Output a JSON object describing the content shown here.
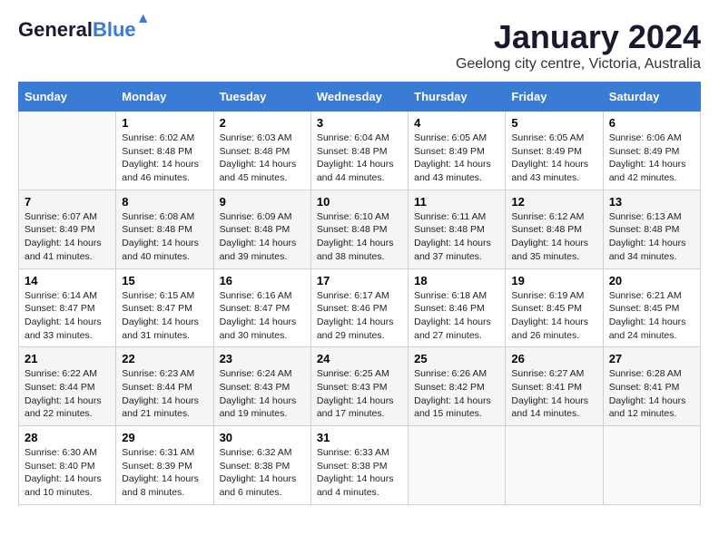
{
  "header": {
    "logo_general": "General",
    "logo_blue": "Blue",
    "month": "January 2024",
    "location": "Geelong city centre, Victoria, Australia"
  },
  "days_of_week": [
    "Sunday",
    "Monday",
    "Tuesday",
    "Wednesday",
    "Thursday",
    "Friday",
    "Saturday"
  ],
  "weeks": [
    [
      {
        "day": "",
        "info": ""
      },
      {
        "day": "1",
        "info": "Sunrise: 6:02 AM\nSunset: 8:48 PM\nDaylight: 14 hours\nand 46 minutes."
      },
      {
        "day": "2",
        "info": "Sunrise: 6:03 AM\nSunset: 8:48 PM\nDaylight: 14 hours\nand 45 minutes."
      },
      {
        "day": "3",
        "info": "Sunrise: 6:04 AM\nSunset: 8:48 PM\nDaylight: 14 hours\nand 44 minutes."
      },
      {
        "day": "4",
        "info": "Sunrise: 6:05 AM\nSunset: 8:49 PM\nDaylight: 14 hours\nand 43 minutes."
      },
      {
        "day": "5",
        "info": "Sunrise: 6:05 AM\nSunset: 8:49 PM\nDaylight: 14 hours\nand 43 minutes."
      },
      {
        "day": "6",
        "info": "Sunrise: 6:06 AM\nSunset: 8:49 PM\nDaylight: 14 hours\nand 42 minutes."
      }
    ],
    [
      {
        "day": "7",
        "info": "Sunrise: 6:07 AM\nSunset: 8:49 PM\nDaylight: 14 hours\nand 41 minutes."
      },
      {
        "day": "8",
        "info": "Sunrise: 6:08 AM\nSunset: 8:48 PM\nDaylight: 14 hours\nand 40 minutes."
      },
      {
        "day": "9",
        "info": "Sunrise: 6:09 AM\nSunset: 8:48 PM\nDaylight: 14 hours\nand 39 minutes."
      },
      {
        "day": "10",
        "info": "Sunrise: 6:10 AM\nSunset: 8:48 PM\nDaylight: 14 hours\nand 38 minutes."
      },
      {
        "day": "11",
        "info": "Sunrise: 6:11 AM\nSunset: 8:48 PM\nDaylight: 14 hours\nand 37 minutes."
      },
      {
        "day": "12",
        "info": "Sunrise: 6:12 AM\nSunset: 8:48 PM\nDaylight: 14 hours\nand 35 minutes."
      },
      {
        "day": "13",
        "info": "Sunrise: 6:13 AM\nSunset: 8:48 PM\nDaylight: 14 hours\nand 34 minutes."
      }
    ],
    [
      {
        "day": "14",
        "info": "Sunrise: 6:14 AM\nSunset: 8:47 PM\nDaylight: 14 hours\nand 33 minutes."
      },
      {
        "day": "15",
        "info": "Sunrise: 6:15 AM\nSunset: 8:47 PM\nDaylight: 14 hours\nand 31 minutes."
      },
      {
        "day": "16",
        "info": "Sunrise: 6:16 AM\nSunset: 8:47 PM\nDaylight: 14 hours\nand 30 minutes."
      },
      {
        "day": "17",
        "info": "Sunrise: 6:17 AM\nSunset: 8:46 PM\nDaylight: 14 hours\nand 29 minutes."
      },
      {
        "day": "18",
        "info": "Sunrise: 6:18 AM\nSunset: 8:46 PM\nDaylight: 14 hours\nand 27 minutes."
      },
      {
        "day": "19",
        "info": "Sunrise: 6:19 AM\nSunset: 8:45 PM\nDaylight: 14 hours\nand 26 minutes."
      },
      {
        "day": "20",
        "info": "Sunrise: 6:21 AM\nSunset: 8:45 PM\nDaylight: 14 hours\nand 24 minutes."
      }
    ],
    [
      {
        "day": "21",
        "info": "Sunrise: 6:22 AM\nSunset: 8:44 PM\nDaylight: 14 hours\nand 22 minutes."
      },
      {
        "day": "22",
        "info": "Sunrise: 6:23 AM\nSunset: 8:44 PM\nDaylight: 14 hours\nand 21 minutes."
      },
      {
        "day": "23",
        "info": "Sunrise: 6:24 AM\nSunset: 8:43 PM\nDaylight: 14 hours\nand 19 minutes."
      },
      {
        "day": "24",
        "info": "Sunrise: 6:25 AM\nSunset: 8:43 PM\nDaylight: 14 hours\nand 17 minutes."
      },
      {
        "day": "25",
        "info": "Sunrise: 6:26 AM\nSunset: 8:42 PM\nDaylight: 14 hours\nand 15 minutes."
      },
      {
        "day": "26",
        "info": "Sunrise: 6:27 AM\nSunset: 8:41 PM\nDaylight: 14 hours\nand 14 minutes."
      },
      {
        "day": "27",
        "info": "Sunrise: 6:28 AM\nSunset: 8:41 PM\nDaylight: 14 hours\nand 12 minutes."
      }
    ],
    [
      {
        "day": "28",
        "info": "Sunrise: 6:30 AM\nSunset: 8:40 PM\nDaylight: 14 hours\nand 10 minutes."
      },
      {
        "day": "29",
        "info": "Sunrise: 6:31 AM\nSunset: 8:39 PM\nDaylight: 14 hours\nand 8 minutes."
      },
      {
        "day": "30",
        "info": "Sunrise: 6:32 AM\nSunset: 8:38 PM\nDaylight: 14 hours\nand 6 minutes."
      },
      {
        "day": "31",
        "info": "Sunrise: 6:33 AM\nSunset: 8:38 PM\nDaylight: 14 hours\nand 4 minutes."
      },
      {
        "day": "",
        "info": ""
      },
      {
        "day": "",
        "info": ""
      },
      {
        "day": "",
        "info": ""
      }
    ]
  ]
}
